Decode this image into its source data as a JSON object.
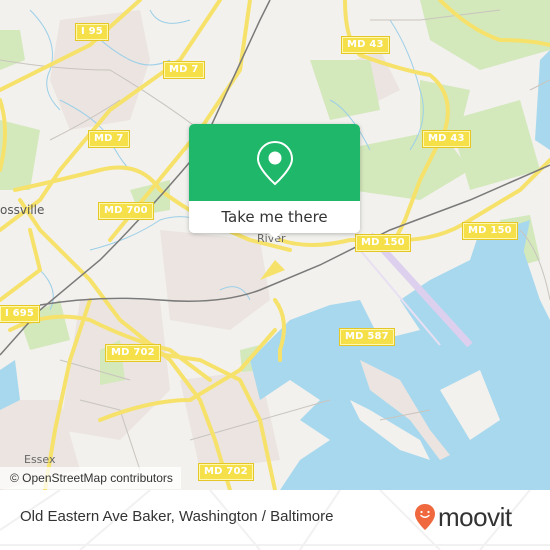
{
  "map": {
    "road_shields": [
      {
        "label": "I 95"
      },
      {
        "label": "MD 7"
      },
      {
        "label": "MD 7"
      },
      {
        "label": "MD 43"
      },
      {
        "label": "MD 43"
      },
      {
        "label": "MD 700"
      },
      {
        "label": "MD 150"
      },
      {
        "label": "MD 150"
      },
      {
        "label": "I 695"
      },
      {
        "label": "MD 702"
      },
      {
        "label": "MD 587"
      },
      {
        "label": "MD 702"
      }
    ],
    "places": [
      {
        "label": "ossville"
      },
      {
        "label": "Essex"
      },
      {
        "label": "River"
      }
    ],
    "attribution": "© OpenStreetMap contributors",
    "colors": {
      "land": "#f2f1ed",
      "water": "#a8d8ee",
      "park": "#cde6b0",
      "urban": "#e8e0dc",
      "road": "#f6e26a",
      "rail": "#777777",
      "airport": "#e2d8f0"
    }
  },
  "popup": {
    "icon": "map-pin-icon",
    "button_label": "Take me there",
    "accent_color": "#1fb86a"
  },
  "footer": {
    "title": "Old Eastern Ave Baker, Washington / Baltimore",
    "brand": "moovit",
    "brand_color": "#f0683e"
  }
}
